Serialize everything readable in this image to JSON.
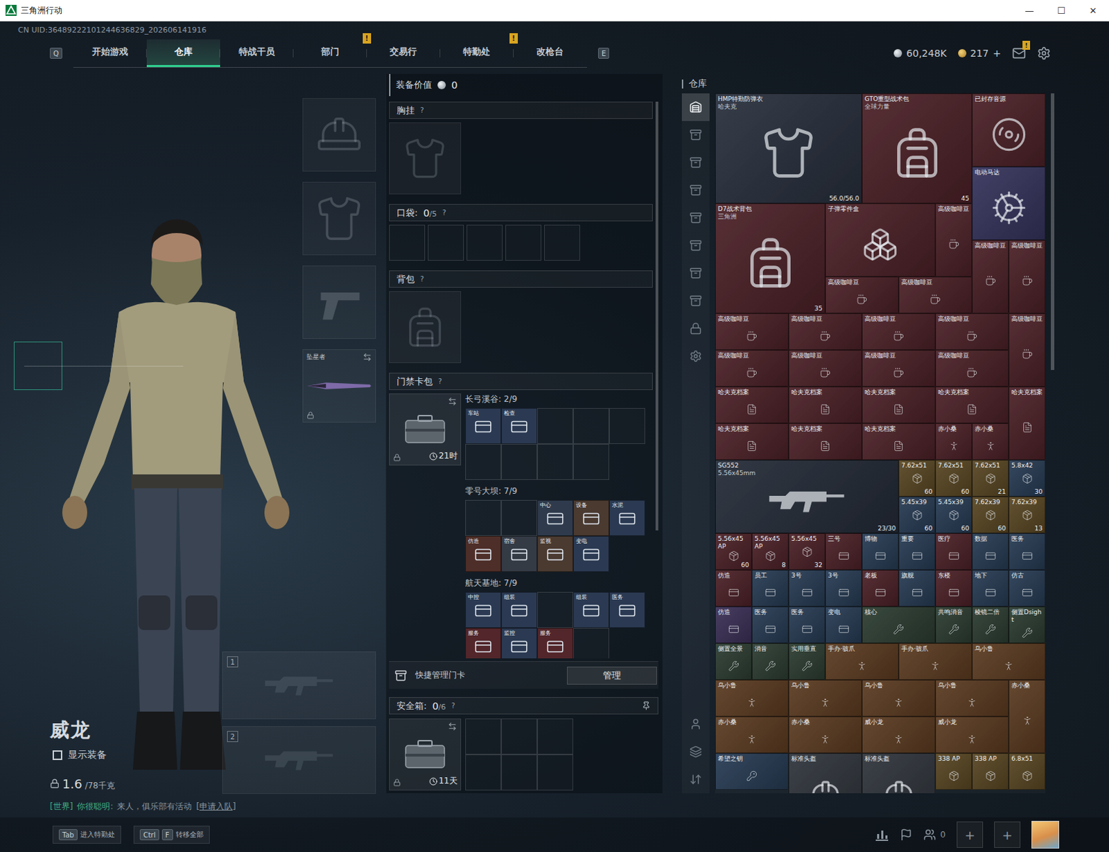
{
  "window": {
    "title": "三角洲行动",
    "controls": [
      "—",
      "☐",
      "✕"
    ]
  },
  "uid": "CN UID:36489222101244636829_202606141916",
  "nav": {
    "left_key": "Q",
    "right_key": "E",
    "tabs": [
      {
        "label": "开始游戏",
        "selected": false
      },
      {
        "label": "仓库",
        "selected": true
      },
      {
        "label": "特战干员",
        "selected": false
      },
      {
        "label": "部门",
        "selected": false,
        "badge": "!"
      },
      {
        "label": "交易行",
        "selected": false
      },
      {
        "label": "特勤处",
        "selected": false,
        "badge": "!"
      },
      {
        "label": "改枪台",
        "selected": false
      }
    ]
  },
  "currency": {
    "coins": "60,248K",
    "tickets": "217",
    "add": "+",
    "mail_badge": "!"
  },
  "character": {
    "name": "威龙",
    "show_gear": {
      "label": "显示装备",
      "checked": false
    },
    "weight": "1.6",
    "weight_max": "/78千克",
    "chat": {
      "channel": "[世界]",
      "sender": "你很聪明:",
      "message": "来人，俱乐部有活动",
      "link": "[申请入队]"
    }
  },
  "gear_slots": [
    {
      "kind": "helmet",
      "label": "",
      "locked": false
    },
    {
      "kind": "armor",
      "label": "",
      "locked": false
    },
    {
      "kind": "pistol",
      "label": "",
      "locked": false
    },
    {
      "kind": "melee",
      "label": "坠星者",
      "locked": true
    }
  ],
  "weapon_slots": [
    "1",
    "2"
  ],
  "loadout": {
    "value_label": "装备价值",
    "value": "0",
    "chest": {
      "label": "胸挂",
      "help": "?"
    },
    "pockets": {
      "label": "口袋:",
      "count": "0",
      "capacity": "/5",
      "help": "?",
      "slots": 5
    },
    "backpack": {
      "label": "背包",
      "help": "?"
    },
    "keycard_case": {
      "label": "门禁卡包",
      "help": "?",
      "timer": "21时",
      "locked": true,
      "maps": [
        {
          "title": "长弓溪谷: 2/9",
          "slots": [
            {
              "filled": true,
              "label": "车站",
              "color": "#2b3a52"
            },
            {
              "filled": true,
              "label": "检查",
              "color": "#2b3a52"
            },
            {
              "filled": false,
              "label": ""
            },
            {
              "filled": false,
              "label": ""
            },
            {
              "filled": false,
              "label": ""
            },
            {
              "filled": false,
              "label": ""
            },
            {
              "filled": false,
              "label": ""
            },
            {
              "filled": false,
              "label": ""
            },
            {
              "filled": false,
              "label": ""
            }
          ]
        },
        {
          "title": "零号大坝: 7/9",
          "slots": [
            {
              "filled": false,
              "label": ""
            },
            {
              "filled": false,
              "label": ""
            },
            {
              "filled": true,
              "label": "中心",
              "color": "#2f3b4d"
            },
            {
              "filled": true,
              "label": "设备",
              "color": "#4a3a30"
            },
            {
              "filled": true,
              "label": "水泥",
              "color": "#2b3a52"
            },
            {
              "filled": true,
              "label": "仿造",
              "color": "#4e2e28"
            },
            {
              "filled": true,
              "label": "宿舍",
              "color": "#353b45"
            },
            {
              "filled": true,
              "label": "监视",
              "color": "#4a3a30"
            },
            {
              "filled": true,
              "label": "变电",
              "color": "#2b3a52"
            }
          ]
        },
        {
          "title": "航天基地: 7/9",
          "slots": [
            {
              "filled": true,
              "label": "中控",
              "color": "#2b3a52"
            },
            {
              "filled": true,
              "label": "组装",
              "color": "#2b3a52"
            },
            {
              "filled": false,
              "label": ""
            },
            {
              "filled": true,
              "label": "组装",
              "color": "#2b3a52"
            },
            {
              "filled": true,
              "label": "医务",
              "color": "#2b3a52"
            },
            {
              "filled": true,
              "label": "服务",
              "color": "#52262a"
            },
            {
              "filled": true,
              "label": "监控",
              "color": "#2b3a52"
            },
            {
              "filled": true,
              "label": "服务",
              "color": "#52262a"
            },
            {
              "filled": false,
              "label": ""
            }
          ]
        }
      ]
    },
    "quick_manage": {
      "label": "快捷管理门卡",
      "button": "管理"
    },
    "safe_box": {
      "label": "安全箱:",
      "count": "0",
      "capacity": "/6",
      "help": "?",
      "timer": "11天",
      "locked": true,
      "slots": 6
    }
  },
  "warehouse": {
    "title": "仓库",
    "tabs": [
      {
        "selected": true
      },
      {
        "selected": false
      },
      {
        "selected": false
      },
      {
        "selected": false
      },
      {
        "selected": false
      },
      {
        "selected": false
      },
      {
        "selected": false
      },
      {
        "selected": false
      },
      {
        "selected": false
      },
      {
        "selected": false
      }
    ],
    "items": [
      {
        "kind": "armor",
        "label": "HMP特勤防弹衣",
        "sub": "哈夫克",
        "count": "56.0/56.0",
        "color": "#272e3b"
      },
      {
        "kind": "pack",
        "label": "GTO重型战术包",
        "sub": "全球力量",
        "count": "45",
        "color": "#4a2026"
      },
      {
        "kind": "recorder",
        "label": "已封存音源",
        "color": "#4a2026"
      },
      {
        "kind": "motor",
        "label": "电动马达",
        "color": "#34325a"
      },
      {
        "kind": "pack",
        "label": "D7战术背包",
        "sub": "三角洲",
        "count": "35",
        "color": "#4a2026"
      },
      {
        "kind": "crate",
        "label": "子弹零件盒",
        "color": "#4a2026"
      },
      {
        "kind": "coffee",
        "label": "高级咖啡豆",
        "color": "#4a2026"
      },
      {
        "kind": "coffee",
        "label": "高级咖啡豆",
        "color": "#4a2026"
      },
      {
        "kind": "coffee",
        "label": "高级咖啡豆",
        "color": "#4a2026"
      },
      {
        "kind": "coffeewide",
        "label": "高级咖啡豆",
        "color": "#4a2026"
      },
      {
        "kind": "coffeewide",
        "label": "高级咖啡豆",
        "color": "#4a2026"
      },
      {
        "kind": "coffeewide",
        "label": "高级咖啡豆",
        "color": "#4a2026"
      },
      {
        "kind": "coffeewide",
        "label": "高级咖啡豆",
        "color": "#4a2026"
      },
      {
        "kind": "coffeewide",
        "label": "高级咖啡豆",
        "color": "#4a2026"
      },
      {
        "kind": "coffeewide",
        "label": "高级咖啡豆",
        "color": "#4a2026"
      },
      {
        "kind": "coffee",
        "label": "高级咖啡豆",
        "color": "#4a2026"
      },
      {
        "kind": "coffeewide",
        "label": "高级咖啡豆",
        "color": "#4a2026"
      },
      {
        "kind": "coffeewide",
        "label": "高级咖啡豆",
        "color": "#4a2026"
      },
      {
        "kind": "coffeewide",
        "label": "高级咖啡豆",
        "color": "#4a2026"
      },
      {
        "kind": "coffeewide",
        "label": "高级咖啡豆",
        "color": "#4a2026"
      },
      {
        "kind": "dossier",
        "label": "哈夫克档案",
        "color": "#4a2026"
      },
      {
        "kind": "dossier",
        "label": "哈夫克档案",
        "color": "#4a2026"
      },
      {
        "kind": "dossier",
        "label": "哈夫克档案",
        "color": "#4a2026"
      },
      {
        "kind": "dossier",
        "label": "哈夫克档案",
        "color": "#4a2026"
      },
      {
        "kind": "dossiertall",
        "label": "哈夫克档案",
        "color": "#4a2026"
      },
      {
        "kind": "dossier",
        "label": "哈夫克档案",
        "color": "#4a2026"
      },
      {
        "kind": "dossier",
        "label": "哈夫克档案",
        "color": "#4a2026"
      },
      {
        "kind": "dossier",
        "label": "哈夫克档案",
        "color": "#4a2026"
      },
      {
        "kind": "figurine",
        "label": "赤小桑",
        "color": "#4a2026"
      },
      {
        "kind": "figurine",
        "label": "赤小桑",
        "color": "#4a2026"
      },
      {
        "kind": "rifle",
        "label": "SG552",
        "sub": "5.56x45mm",
        "count": "23/30",
        "color": "#232a36"
      },
      {
        "kind": "ammo",
        "label": "7.62x51",
        "count": "60",
        "color": "#574522"
      },
      {
        "kind": "ammo",
        "label": "7.62x51",
        "count": "60",
        "color": "#574522"
      },
      {
        "kind": "ammo",
        "label": "7.62x51",
        "count": "21",
        "color": "#574522"
      },
      {
        "kind": "ammo",
        "label": "5.8x42",
        "count": "30",
        "color": "#263a52"
      },
      {
        "kind": "ammo",
        "label": "5.45x39",
        "count": "60",
        "color": "#263a52"
      },
      {
        "kind": "ammo",
        "label": "5.45x39",
        "count": "60",
        "color": "#263a52"
      },
      {
        "kind": "ammo",
        "label": "7.62x39",
        "count": "60",
        "color": "#574522"
      },
      {
        "kind": "ammo",
        "label": "7.62x39",
        "count": "13",
        "color": "#574522"
      },
      {
        "kind": "ammo",
        "label": "5.56x45 AP",
        "count": "60",
        "color": "#4a2026"
      },
      {
        "kind": "ammo",
        "label": "5.56x45 AP",
        "count": "8",
        "color": "#4a2026"
      },
      {
        "kind": "ammo",
        "label": "5.56x45",
        "count": "32",
        "color": "#4a2026"
      },
      {
        "kind": "keycard",
        "label": "三号",
        "color": "#4a2026"
      },
      {
        "kind": "keycard",
        "label": "博物",
        "color": "#263a52"
      },
      {
        "kind": "keycard",
        "label": "重要",
        "color": "#263a52"
      },
      {
        "kind": "keycard",
        "label": "医疗",
        "color": "#4a2026"
      },
      {
        "kind": "keycard",
        "label": "数据",
        "color": "#263a52"
      },
      {
        "kind": "keycard",
        "label": "医务",
        "color": "#263a52"
      },
      {
        "kind": "keycard",
        "label": "仿造",
        "color": "#4a2026"
      },
      {
        "kind": "keycard",
        "label": "员工",
        "color": "#263a52"
      },
      {
        "kind": "keycard",
        "label": "3号",
        "color": "#263a52"
      },
      {
        "kind": "keycard",
        "label": "3号",
        "color": "#263a52"
      },
      {
        "kind": "keycard",
        "label": "老板",
        "color": "#4a2026"
      },
      {
        "kind": "keycard",
        "label": "旗舰",
        "color": "#263a52"
      },
      {
        "kind": "keycard",
        "label": "东楼",
        "color": "#4a2026"
      },
      {
        "kind": "keycard",
        "label": "地下",
        "color": "#263a52"
      },
      {
        "kind": "keycard",
        "label": "仿古",
        "color": "#263a52"
      },
      {
        "kind": "keycard",
        "label": "仿造",
        "color": "#3a2f55"
      },
      {
        "kind": "keycard",
        "label": "医务",
        "color": "#263a52"
      },
      {
        "kind": "keycard",
        "label": "医务",
        "color": "#263a52"
      },
      {
        "kind": "keycard",
        "label": "变电",
        "color": "#263a52"
      },
      {
        "kind": "stock",
        "label": "核心",
        "color": "#2b3b30"
      },
      {
        "kind": "part",
        "label": "共鸣消音",
        "color": "#2b3b30"
      },
      {
        "kind": "part",
        "label": "棱镜二倍",
        "color": "#2b3b30"
      },
      {
        "kind": "part",
        "label": "侧置Dsight",
        "color": "#2b3b30"
      },
      {
        "kind": "part",
        "label": "侧置全景",
        "color": "#2b3b30"
      },
      {
        "kind": "part",
        "label": "消音",
        "color": "#2b3b30"
      },
      {
        "kind": "part",
        "label": "实用垂直",
        "color": "#2b3b30"
      },
      {
        "kind": "toy",
        "label": "手办·骇爪",
        "color": "#5a3a20"
      },
      {
        "kind": "toy",
        "label": "手办·骇爪",
        "color": "#5a3a20"
      },
      {
        "kind": "toy",
        "label": "乌小鲁",
        "color": "#5a3a20"
      },
      {
        "kind": "toy",
        "label": "乌小鲁",
        "color": "#5a3a20"
      },
      {
        "kind": "toy",
        "label": "乌小鲁",
        "color": "#5a3a20"
      },
      {
        "kind": "toy",
        "label": "乌小鲁",
        "color": "#5a3a20"
      },
      {
        "kind": "toy",
        "label": "乌小鲁",
        "color": "#5a3a20"
      },
      {
        "kind": "toytall",
        "label": "赤小桑",
        "color": "#5a3a20"
      },
      {
        "kind": "toy",
        "label": "赤小桑",
        "color": "#5a3a20"
      },
      {
        "kind": "toy",
        "label": "赤小桑",
        "color": "#5a3a20"
      },
      {
        "kind": "toy",
        "label": "威小龙",
        "color": "#5a3a20"
      },
      {
        "kind": "toy",
        "label": "威小龙",
        "color": "#5a3a20"
      },
      {
        "kind": "key",
        "label": "希望之钥",
        "color": "#263a52"
      },
      {
        "kind": "helmet",
        "label": "标准头盔",
        "color": "#2e333a"
      },
      {
        "kind": "helmet",
        "label": "标准头盔",
        "color": "#2e333a"
      },
      {
        "kind": "ammo",
        "label": "338 AP",
        "color": "#574522"
      },
      {
        "kind": "ammo",
        "label": "338 AP",
        "color": "#574522"
      },
      {
        "kind": "ammo",
        "label": "6.8x51",
        "color": "#574522"
      }
    ]
  },
  "hints": [
    {
      "keys": [
        "Tab"
      ],
      "label": "进入特勤处"
    },
    {
      "keys": [
        "Ctrl",
        "F"
      ],
      "label": "转移全部"
    }
  ],
  "social": {
    "friends": "0",
    "invite": [
      "+",
      "+"
    ]
  }
}
